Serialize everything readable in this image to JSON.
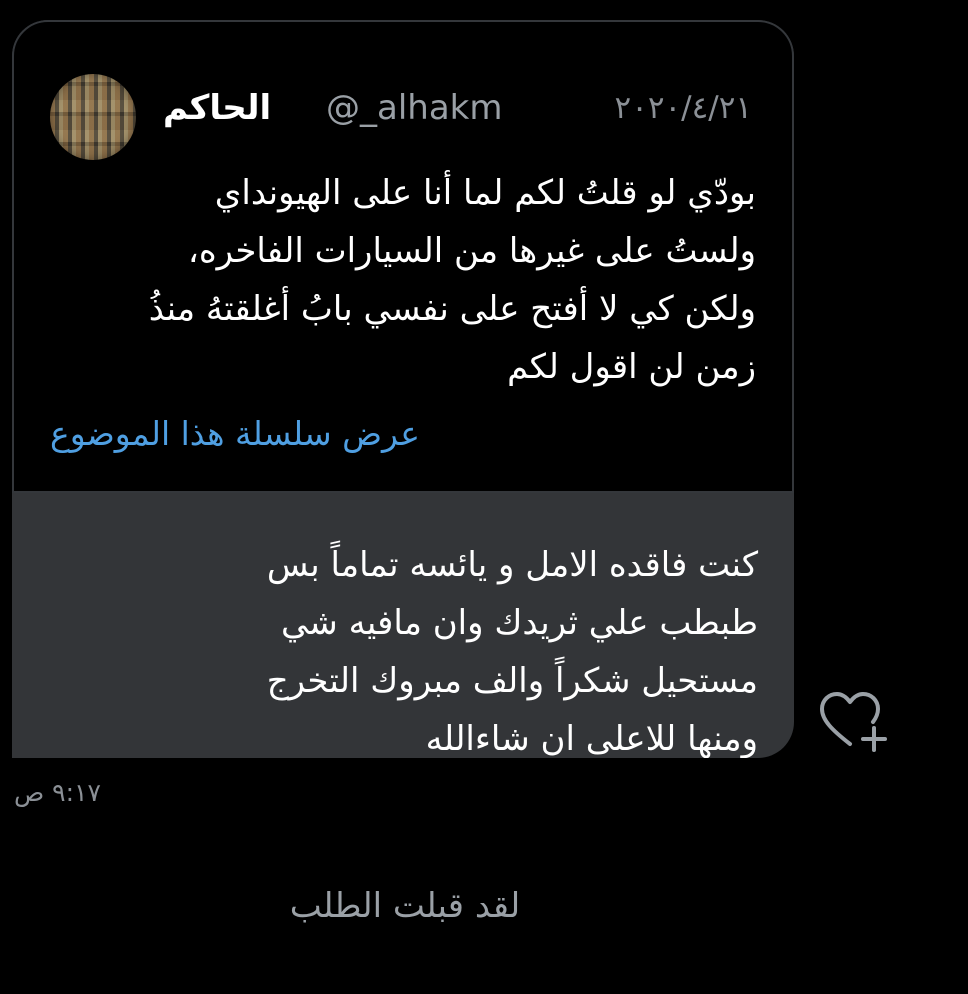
{
  "quoted_tweet": {
    "display_name": "الحاكم",
    "handle": "@_alhakm",
    "date": "٢٠٢٠/٤/٢١",
    "body_lines": [
      "بودّي لو قلتُ لكم لما أنا على الهيونداي",
      "ولستُ على غيرها من السيارات الفاخره،",
      "ولكن كي لا أفتح على نفسي بابُ أغلقتهُ منذُ",
      "زمن لن اقول لكم"
    ],
    "thread_link": "عرض سلسلة هذا الموضوع"
  },
  "message": {
    "lines": [
      "كنت فاقده الامل و يائسه تماماً بس",
      "طبطب علي ثريدك وان مافيه شي",
      "مستحيل شكراً والف مبروك التخرج",
      "ومنها للاعلى ان شاءالله"
    ],
    "timestamp": "٩:١٧ ص",
    "react_icon": "heart-plus-icon"
  },
  "system_note": "لقد قبلت الطلب",
  "colors": {
    "background": "#000000",
    "bubble": "#333538",
    "link": "#4f9fe2",
    "muted": "#8b9096"
  }
}
